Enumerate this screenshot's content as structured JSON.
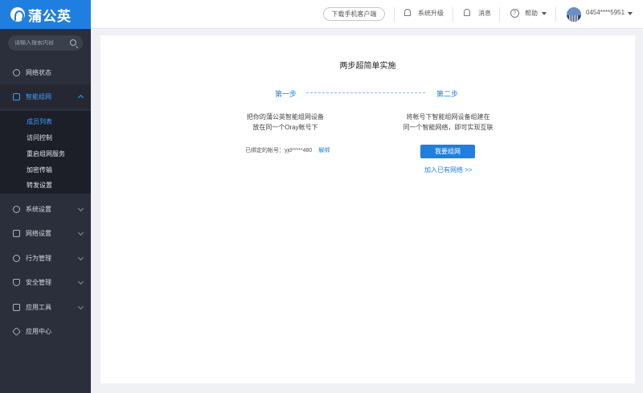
{
  "brand": {
    "name": "蒲公英"
  },
  "search": {
    "placeholder": "请输入搜索内容"
  },
  "sidebar": {
    "items": [
      {
        "label": "网络状态",
        "icon": "network-status-icon"
      },
      {
        "label": "智能组网",
        "icon": "smart-network-icon",
        "active": true
      },
      {
        "label": "系统设置",
        "icon": "gear-icon"
      },
      {
        "label": "网络设置",
        "icon": "network-settings-icon"
      },
      {
        "label": "行为管理",
        "icon": "behavior-icon"
      },
      {
        "label": "安全管理",
        "icon": "shield-icon"
      },
      {
        "label": "应用工具",
        "icon": "toolbox-icon"
      },
      {
        "label": "应用中心",
        "icon": "cube-icon"
      }
    ],
    "subitems": [
      {
        "label": "成员列表",
        "active": true
      },
      {
        "label": "访问控制"
      },
      {
        "label": "重启组网服务"
      },
      {
        "label": "加密传输"
      },
      {
        "label": "转发设置"
      }
    ]
  },
  "header": {
    "download_label": "下载手机客户端",
    "upgrade_label": "系统升级",
    "messages_label": "消息",
    "help_label": "帮助",
    "account": "0454****5951"
  },
  "main": {
    "title": "两步超简单实施",
    "step1": {
      "label": "第一步",
      "line1": "把你的蒲公英智能组网设备",
      "line2": "放在同一个Oray帐号下"
    },
    "step2": {
      "label": "第二步",
      "line1": "将帐号下智能组网设备组建在",
      "line2": "同一个智能网络，即可实现互联"
    },
    "bound_text": "已绑定的帐号：yjd*****480",
    "unbind_label": "解绑",
    "create_button": "我要组网",
    "join_link": "加入已有网络 >>"
  },
  "colors": {
    "accent": "#1f7fe0",
    "sidebar_bg": "#2b2f3b"
  }
}
